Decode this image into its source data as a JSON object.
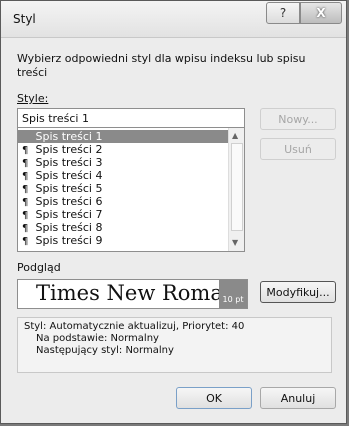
{
  "window": {
    "title": "Styl",
    "help_glyph": "?",
    "close_glyph": "X"
  },
  "instructions": "Wybierz odpowiedni styl dla wpisu indeksu lub spisu treści",
  "style_label": "Style:",
  "style_input_value": "Spis treści 1",
  "buttons": {
    "new": "Nowy...",
    "delete": "Usuń",
    "modify": "Modyfikuj...",
    "ok": "OK",
    "cancel": "Anuluj"
  },
  "styles_list": [
    {
      "label": "Spis treści 1",
      "selected": true
    },
    {
      "label": "Spis treści 2",
      "selected": false
    },
    {
      "label": "Spis treści 3",
      "selected": false
    },
    {
      "label": "Spis treści 4",
      "selected": false
    },
    {
      "label": "Spis treści 5",
      "selected": false
    },
    {
      "label": "Spis treści 6",
      "selected": false
    },
    {
      "label": "Spis treści 7",
      "selected": false
    },
    {
      "label": "Spis treści 8",
      "selected": false
    },
    {
      "label": "Spis treści 9",
      "selected": false
    }
  ],
  "paragraph_glyph": "¶",
  "preview": {
    "label": "Podgląd",
    "font_name": "Times New Roman",
    "size": "10 pt"
  },
  "description": {
    "line1": "Styl: Automatycznie aktualizuj, Priorytet: 40",
    "line2": "Na podstawie: Normalny",
    "line3": "Następujący styl: Normalny"
  },
  "colors": {
    "selection": "#8a8a8a",
    "dialog_bg": "#ececec"
  }
}
